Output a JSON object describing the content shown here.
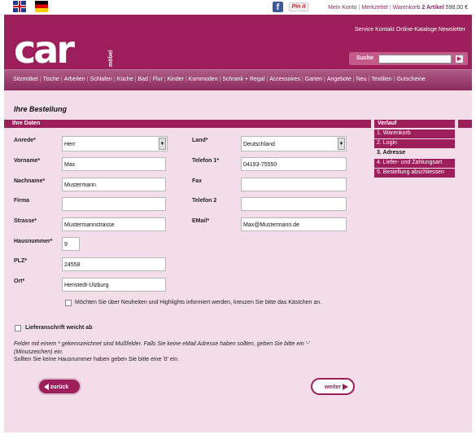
{
  "toplinks": {
    "konto": "Mein Konto",
    "merkzettel": "Merkzettel",
    "warenkorb": "Warenkorb",
    "artikel": "2 Artikel",
    "amount": "598,00 €"
  },
  "social": {
    "facebook": "f",
    "pinterest": "Pin it"
  },
  "header": {
    "logo": "car",
    "logo_sub": "möbel",
    "links": "Service Kontakt Online-Kataloge Newsletter",
    "search_label": "Suche",
    "search_value": "",
    "search_go": "▶"
  },
  "nav": [
    "Sitzmöbel",
    "Tische",
    "Arbeiten",
    "Schlafen",
    "Küche",
    "Bad",
    "Flur",
    "Kinder",
    "Kommoden",
    "Schrank + Regal",
    "Accessoires",
    "Garten",
    "Angebote",
    "Neu",
    "Textilien",
    "Gutscheine"
  ],
  "page_title": "Ihre Bestellung",
  "section_title": "Ihre Daten",
  "form": {
    "anrede_label": "Anrede*",
    "anrede_value": "Herr",
    "vorname_label": "Vorname*",
    "vorname_value": "Max",
    "nachname_label": "Nachname*",
    "nachname_value": "Mustermann",
    "firma_label": "Firma",
    "firma_value": "",
    "strasse_label": "Strasse*",
    "strasse_value": "Mustermannstrasse",
    "hausnummer_label": "Hausnummer*",
    "hausnummer_value": "9",
    "plz_label": "PLZ*",
    "plz_value": "24558",
    "ort_label": "Ort*",
    "ort_value": "Henstedt-Ulzburg",
    "land_label": "Land*",
    "land_value": "Deutschland",
    "telefon1_label": "Telefon 1*",
    "telefon1_value": "04193-75550",
    "fax_label": "Fax",
    "fax_value": "",
    "telefon2_label": "Telefon 2",
    "telefon2_value": "",
    "email_label": "EMail*",
    "email_value": "Max@Mustermann.de",
    "newsletter_label": "Möchten Sie über Neuheiten und Highlights informiert werden, kreuzen Sie bitte das Kästchen an.",
    "lieferanschrift_label": "Lieferanschrift weicht ab"
  },
  "notes": {
    "line1": "Felder mit einem * gekennzeichnet sind Mußfelder. Falls Sie keine eMail Adresse haben sollten, geben Sie bitte ein '-'",
    "line2": "(Minuszeichen) ein.",
    "line3": "Sollten Sie keine Hausnummer haben geben Sie bitte eine '0' ein."
  },
  "buttons": {
    "back": "zurück",
    "next": "weiter"
  },
  "verlauf": {
    "title": "Verlauf",
    "items": [
      "1. Warenkorb",
      "2. Login",
      "3. Adresse",
      "4. Liefer- und Zahlungsart",
      "5. Bestellung abschliessen"
    ],
    "active_index": 2
  },
  "colors": {
    "brand": "#9c1e5b",
    "background": "#f2dde8"
  }
}
